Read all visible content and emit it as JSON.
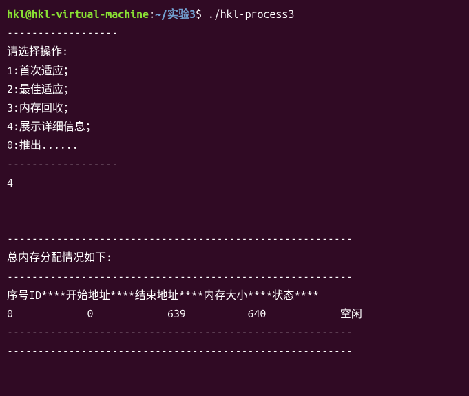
{
  "prompt": {
    "user_host": "hkl@hkl-virtual-machine",
    "colon": ":",
    "path": "~/实验3",
    "dollar": "$ ",
    "command": "./hkl-process3"
  },
  "output": {
    "sep1": "------------------",
    "menu_title": "请选择操作:",
    "menu_1": "1:首次适应；",
    "menu_2": "2:最佳适应；",
    "menu_3": "3:内存回收；",
    "menu_4": "4:展示详细信息；",
    "menu_0": "0:推出......",
    "sep2": "------------------",
    "input": "4",
    "sep3": "--------------------------------------------------------",
    "summary_title": "总内存分配情况如下:",
    "sep4": "--------------------------------------------------------",
    "table_header": "序号ID****开始地址****结束地址****内存大小****状态****",
    "table_row_0": {
      "id": "0",
      "start": "0",
      "end": "639",
      "size": "640",
      "status": "空闲"
    },
    "sep5": "--------------------------------------------------------",
    "sep6": "--------------------------------------------------------"
  }
}
